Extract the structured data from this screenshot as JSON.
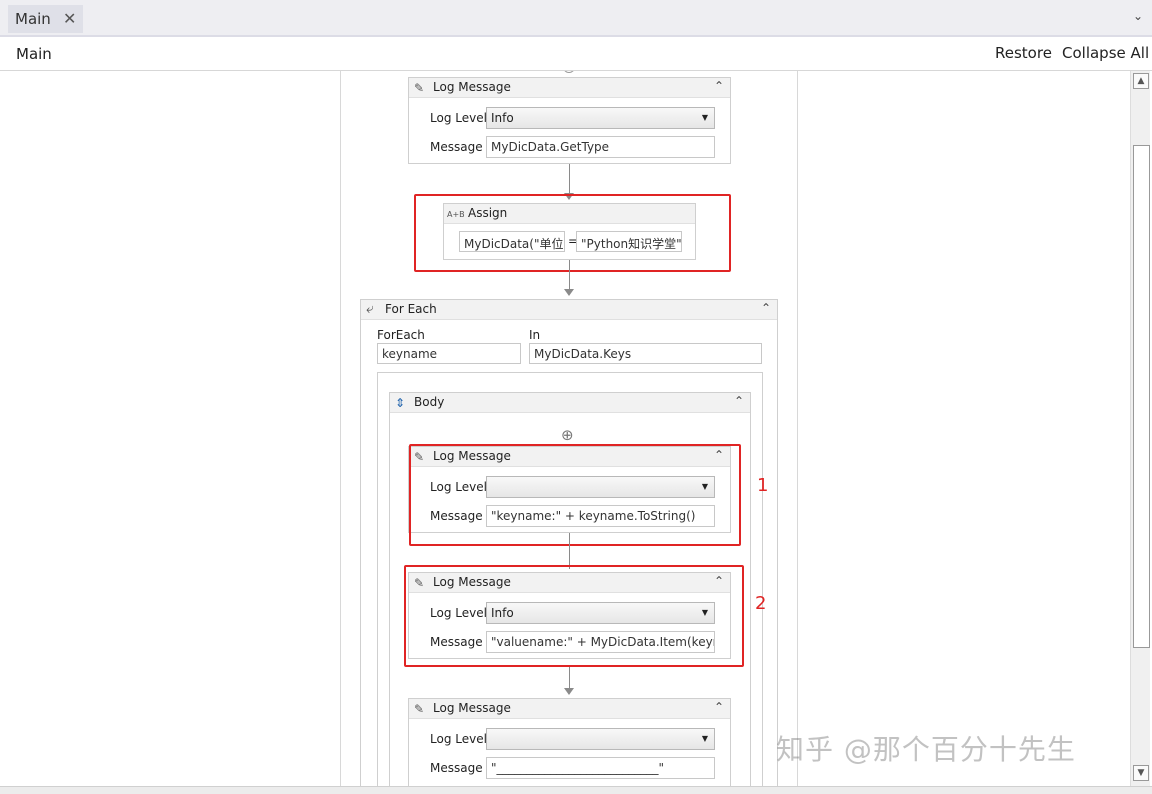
{
  "tab": {
    "label": "Main",
    "close": "✕",
    "chevron": "⌄"
  },
  "header": {
    "title": "Main",
    "restore": "Restore",
    "collapse_all": "Collapse All"
  },
  "activities": {
    "log1": {
      "title": "Log Message",
      "level_label": "Log Level",
      "level_value": "Info",
      "message_label": "Message",
      "message_value": "MyDicData.GetType"
    },
    "assign": {
      "icon": "A+B",
      "title": "Assign",
      "left": "MyDicData(\"单位",
      "eq": "=",
      "right": "\"Python知识学堂\""
    },
    "foreach": {
      "title": "For Each",
      "foreach_label": "ForEach",
      "foreach_value": "keyname",
      "in_label": "In",
      "in_value": "MyDicData.Keys"
    },
    "body": {
      "title": "Body",
      "add": "⊕"
    },
    "log2": {
      "title": "Log Message",
      "level_label": "Log Level",
      "level_value": "",
      "message_label": "Message",
      "message_value": "\"keyname:\" + keyname.ToString()"
    },
    "log3": {
      "title": "Log Message",
      "level_label": "Log Level",
      "level_value": "Info",
      "message_label": "Message",
      "message_value": "\"valuename:\" + MyDicData.Item(keynar"
    },
    "log4": {
      "title": "Log Message",
      "level_label": "Log Level",
      "level_value": "",
      "message_label": "Message",
      "message_value": "\"___________________________\""
    }
  },
  "annotations": {
    "one": "1",
    "two": "2"
  },
  "watermark": "知乎 @那个百分十先生",
  "colors": {
    "highlight": "#e02424",
    "connector": "#8a8a8a"
  }
}
